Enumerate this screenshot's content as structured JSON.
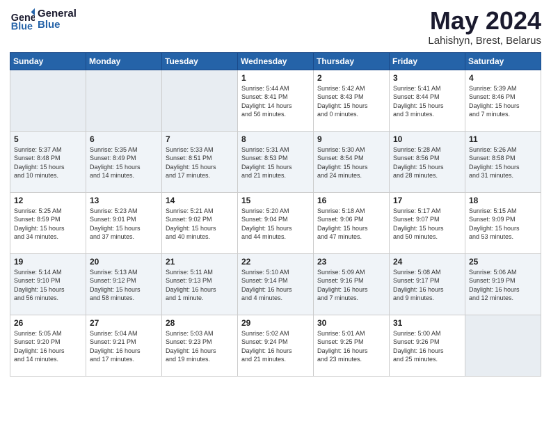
{
  "header": {
    "logo_line1": "General",
    "logo_line2": "Blue",
    "title": "May 2024",
    "subtitle": "Lahishyn, Brest, Belarus"
  },
  "weekdays": [
    "Sunday",
    "Monday",
    "Tuesday",
    "Wednesday",
    "Thursday",
    "Friday",
    "Saturday"
  ],
  "weeks": [
    [
      {
        "day": "",
        "info": ""
      },
      {
        "day": "",
        "info": ""
      },
      {
        "day": "",
        "info": ""
      },
      {
        "day": "1",
        "info": "Sunrise: 5:44 AM\nSunset: 8:41 PM\nDaylight: 14 hours\nand 56 minutes."
      },
      {
        "day": "2",
        "info": "Sunrise: 5:42 AM\nSunset: 8:43 PM\nDaylight: 15 hours\nand 0 minutes."
      },
      {
        "day": "3",
        "info": "Sunrise: 5:41 AM\nSunset: 8:44 PM\nDaylight: 15 hours\nand 3 minutes."
      },
      {
        "day": "4",
        "info": "Sunrise: 5:39 AM\nSunset: 8:46 PM\nDaylight: 15 hours\nand 7 minutes."
      }
    ],
    [
      {
        "day": "5",
        "info": "Sunrise: 5:37 AM\nSunset: 8:48 PM\nDaylight: 15 hours\nand 10 minutes."
      },
      {
        "day": "6",
        "info": "Sunrise: 5:35 AM\nSunset: 8:49 PM\nDaylight: 15 hours\nand 14 minutes."
      },
      {
        "day": "7",
        "info": "Sunrise: 5:33 AM\nSunset: 8:51 PM\nDaylight: 15 hours\nand 17 minutes."
      },
      {
        "day": "8",
        "info": "Sunrise: 5:31 AM\nSunset: 8:53 PM\nDaylight: 15 hours\nand 21 minutes."
      },
      {
        "day": "9",
        "info": "Sunrise: 5:30 AM\nSunset: 8:54 PM\nDaylight: 15 hours\nand 24 minutes."
      },
      {
        "day": "10",
        "info": "Sunrise: 5:28 AM\nSunset: 8:56 PM\nDaylight: 15 hours\nand 28 minutes."
      },
      {
        "day": "11",
        "info": "Sunrise: 5:26 AM\nSunset: 8:58 PM\nDaylight: 15 hours\nand 31 minutes."
      }
    ],
    [
      {
        "day": "12",
        "info": "Sunrise: 5:25 AM\nSunset: 8:59 PM\nDaylight: 15 hours\nand 34 minutes."
      },
      {
        "day": "13",
        "info": "Sunrise: 5:23 AM\nSunset: 9:01 PM\nDaylight: 15 hours\nand 37 minutes."
      },
      {
        "day": "14",
        "info": "Sunrise: 5:21 AM\nSunset: 9:02 PM\nDaylight: 15 hours\nand 40 minutes."
      },
      {
        "day": "15",
        "info": "Sunrise: 5:20 AM\nSunset: 9:04 PM\nDaylight: 15 hours\nand 44 minutes."
      },
      {
        "day": "16",
        "info": "Sunrise: 5:18 AM\nSunset: 9:06 PM\nDaylight: 15 hours\nand 47 minutes."
      },
      {
        "day": "17",
        "info": "Sunrise: 5:17 AM\nSunset: 9:07 PM\nDaylight: 15 hours\nand 50 minutes."
      },
      {
        "day": "18",
        "info": "Sunrise: 5:15 AM\nSunset: 9:09 PM\nDaylight: 15 hours\nand 53 minutes."
      }
    ],
    [
      {
        "day": "19",
        "info": "Sunrise: 5:14 AM\nSunset: 9:10 PM\nDaylight: 15 hours\nand 56 minutes."
      },
      {
        "day": "20",
        "info": "Sunrise: 5:13 AM\nSunset: 9:12 PM\nDaylight: 15 hours\nand 58 minutes."
      },
      {
        "day": "21",
        "info": "Sunrise: 5:11 AM\nSunset: 9:13 PM\nDaylight: 16 hours\nand 1 minute."
      },
      {
        "day": "22",
        "info": "Sunrise: 5:10 AM\nSunset: 9:14 PM\nDaylight: 16 hours\nand 4 minutes."
      },
      {
        "day": "23",
        "info": "Sunrise: 5:09 AM\nSunset: 9:16 PM\nDaylight: 16 hours\nand 7 minutes."
      },
      {
        "day": "24",
        "info": "Sunrise: 5:08 AM\nSunset: 9:17 PM\nDaylight: 16 hours\nand 9 minutes."
      },
      {
        "day": "25",
        "info": "Sunrise: 5:06 AM\nSunset: 9:19 PM\nDaylight: 16 hours\nand 12 minutes."
      }
    ],
    [
      {
        "day": "26",
        "info": "Sunrise: 5:05 AM\nSunset: 9:20 PM\nDaylight: 16 hours\nand 14 minutes."
      },
      {
        "day": "27",
        "info": "Sunrise: 5:04 AM\nSunset: 9:21 PM\nDaylight: 16 hours\nand 17 minutes."
      },
      {
        "day": "28",
        "info": "Sunrise: 5:03 AM\nSunset: 9:23 PM\nDaylight: 16 hours\nand 19 minutes."
      },
      {
        "day": "29",
        "info": "Sunrise: 5:02 AM\nSunset: 9:24 PM\nDaylight: 16 hours\nand 21 minutes."
      },
      {
        "day": "30",
        "info": "Sunrise: 5:01 AM\nSunset: 9:25 PM\nDaylight: 16 hours\nand 23 minutes."
      },
      {
        "day": "31",
        "info": "Sunrise: 5:00 AM\nSunset: 9:26 PM\nDaylight: 16 hours\nand 25 minutes."
      },
      {
        "day": "",
        "info": ""
      }
    ]
  ]
}
